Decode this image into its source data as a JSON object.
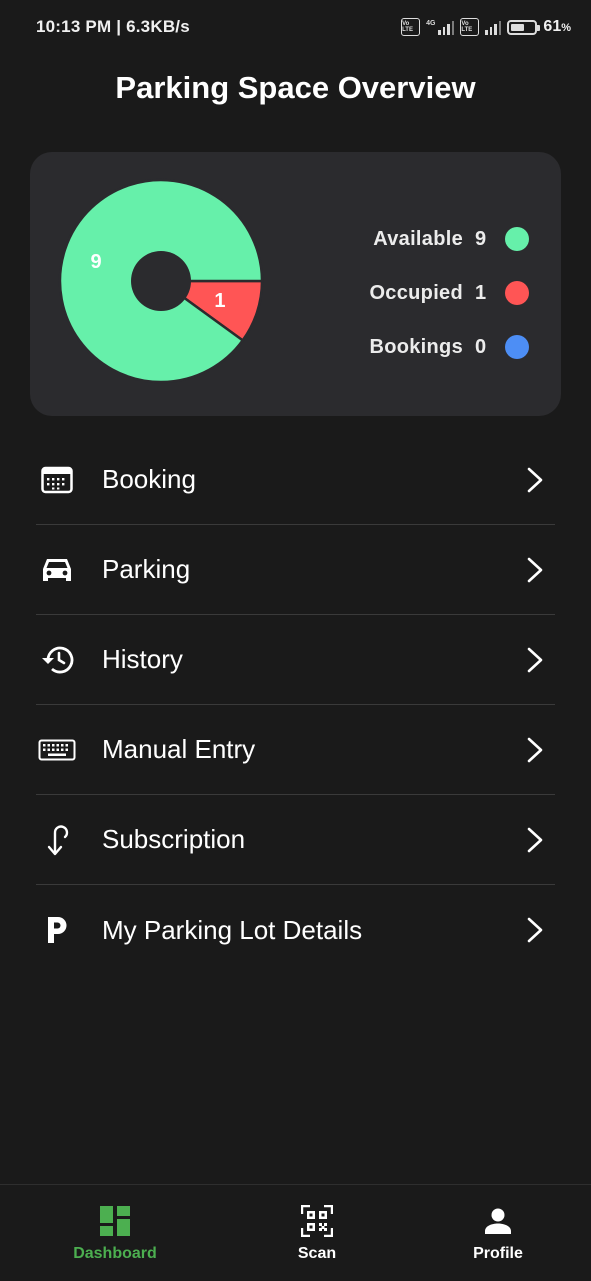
{
  "status_bar": {
    "time_speed": "10:13 PM | 6.3KB/s",
    "volte_1": "Vo LTE",
    "network_type": "4G",
    "volte_2": "Vo LTE",
    "battery_percent": "61",
    "battery_unit": "%",
    "battery_level": 0.61
  },
  "page": {
    "title": "Parking Space Overview"
  },
  "chart_data": {
    "type": "pie",
    "categories": [
      "Available",
      "Occupied",
      "Bookings"
    ],
    "values": [
      9,
      1,
      0
    ],
    "colors": [
      "#66f0aa",
      "#ff5555",
      "#4d8ef5"
    ],
    "donut": true,
    "slice_labels": [
      "9",
      "1"
    ],
    "legend_position": "right"
  },
  "legend": [
    {
      "label": "Available",
      "value": "9",
      "color": "#66f0aa"
    },
    {
      "label": "Occupied",
      "value": "1",
      "color": "#ff5555"
    },
    {
      "label": "Bookings",
      "value": "0",
      "color": "#4d8ef5"
    }
  ],
  "menu": [
    {
      "label": "Booking",
      "icon": "calendar-icon"
    },
    {
      "label": "Parking",
      "icon": "car-icon"
    },
    {
      "label": "History",
      "icon": "history-icon"
    },
    {
      "label": "Manual Entry",
      "icon": "keyboard-icon"
    },
    {
      "label": "Subscription",
      "icon": "subscription-icon"
    },
    {
      "label": "My Parking Lot Details",
      "icon": "parking-p-icon"
    }
  ],
  "bottom_nav": {
    "items": [
      {
        "label": "Dashboard",
        "icon": "dashboard-icon",
        "active": true
      },
      {
        "label": "Scan",
        "icon": "qr-scan-icon",
        "active": false
      },
      {
        "label": "Profile",
        "icon": "person-icon",
        "active": false
      }
    ],
    "active_color": "#4caf50"
  }
}
